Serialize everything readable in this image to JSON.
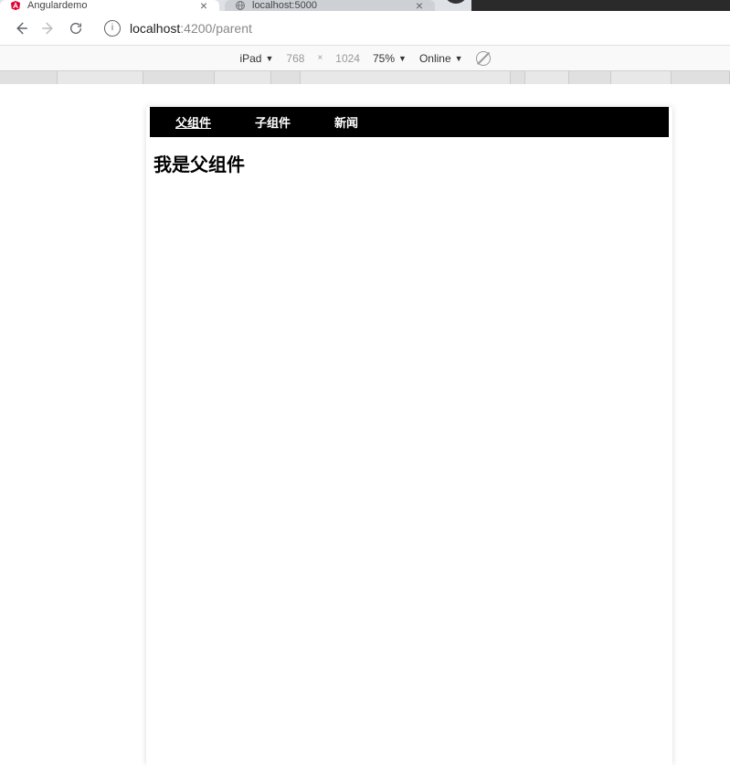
{
  "tabs": {
    "active": {
      "title": "Angulardemo"
    },
    "inactive": {
      "title": "localhost:5000"
    }
  },
  "url": {
    "host": "localhost",
    "port_path": ":4200/parent"
  },
  "device_toolbar": {
    "device": "iPad",
    "width": "768",
    "height": "1024",
    "zoom": "75%",
    "network": "Online"
  },
  "app": {
    "nav": {
      "item1": "父组件",
      "item2": "子组件",
      "item3": "新闻"
    },
    "heading": "我是父组件"
  }
}
